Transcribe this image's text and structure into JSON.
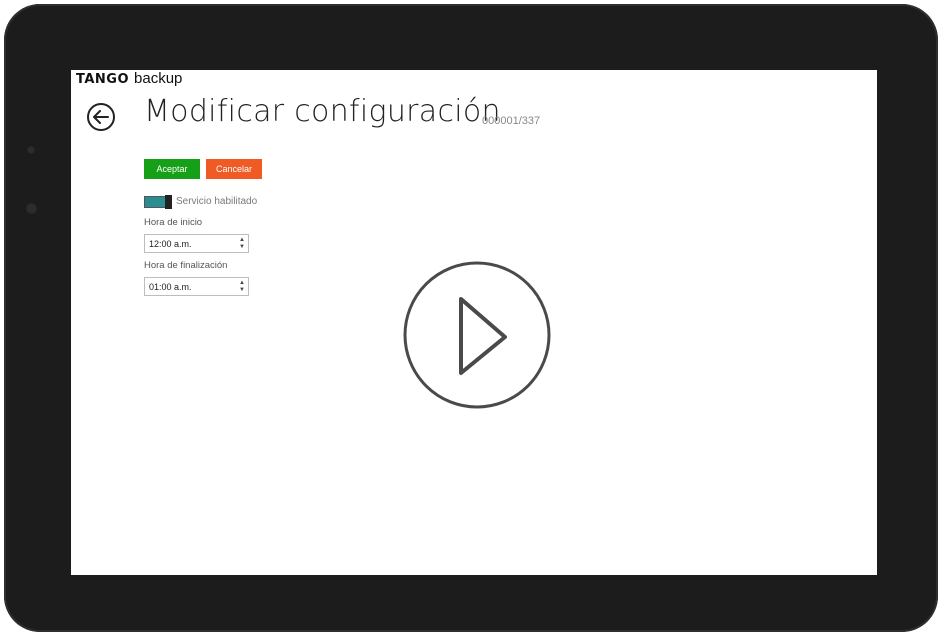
{
  "app": {
    "logo": "TANGO",
    "product": "backup"
  },
  "page": {
    "title": "Modificar configuración",
    "record": "000001/337"
  },
  "actions": {
    "accept_label": "Aceptar",
    "cancel_label": "Cancelar"
  },
  "service": {
    "label": "Servicio habilitado",
    "enabled": true
  },
  "start_time": {
    "label": "Hora de inicio",
    "value": "12:00 a.m."
  },
  "end_time": {
    "label": "Hora de finalización",
    "value": "01:00 a.m."
  },
  "icons": {
    "back": "back-arrow-icon",
    "play": "play-icon",
    "spin_up": "▲",
    "spin_down": "▼"
  },
  "colors": {
    "accept": "#16a018",
    "cancel": "#f05a24",
    "toggle": "#2a8d8f",
    "device": "#1c1c1c"
  }
}
